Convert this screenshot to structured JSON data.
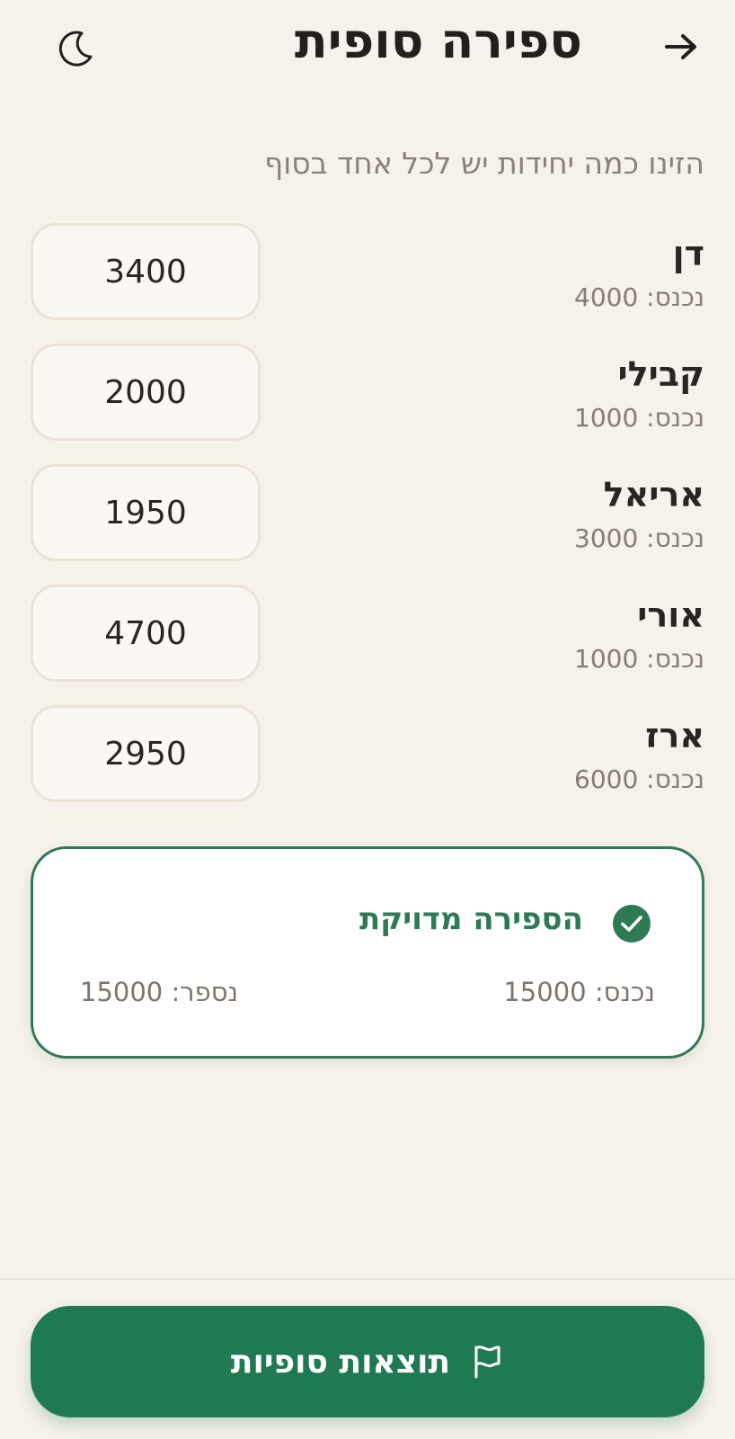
{
  "header": {
    "title": "ספירה סופית",
    "back_icon": "arrow-right-icon",
    "theme_icon": "moon-icon"
  },
  "subtitle": "הזינו כמה יחידות יש לכל אחד בסוף",
  "players": [
    {
      "name": "דן",
      "in_label": "נכנס: 4000",
      "count": "3400"
    },
    {
      "name": "קבילי",
      "in_label": "נכנס: 1000",
      "count": "2000"
    },
    {
      "name": "אריאל",
      "in_label": "נכנס: 3000",
      "count": "1950"
    },
    {
      "name": "אורי",
      "in_label": "נכנס: 1000",
      "count": "4700"
    },
    {
      "name": "ארז",
      "in_label": "נכנס: 6000",
      "count": "2950"
    }
  ],
  "summary": {
    "status": "הספירה מדויקת",
    "status_icon": "check-circle-icon",
    "total_in": "נכנס: 15000",
    "total_counted": "נספר: 15000"
  },
  "footer": {
    "button_label": "תוצאות סופיות",
    "button_icon": "flag-icon"
  },
  "colors": {
    "background": "#f6f1ea",
    "accent_green": "#1f7a52",
    "text_dark": "#2a2522",
    "text_muted": "#857d76"
  }
}
